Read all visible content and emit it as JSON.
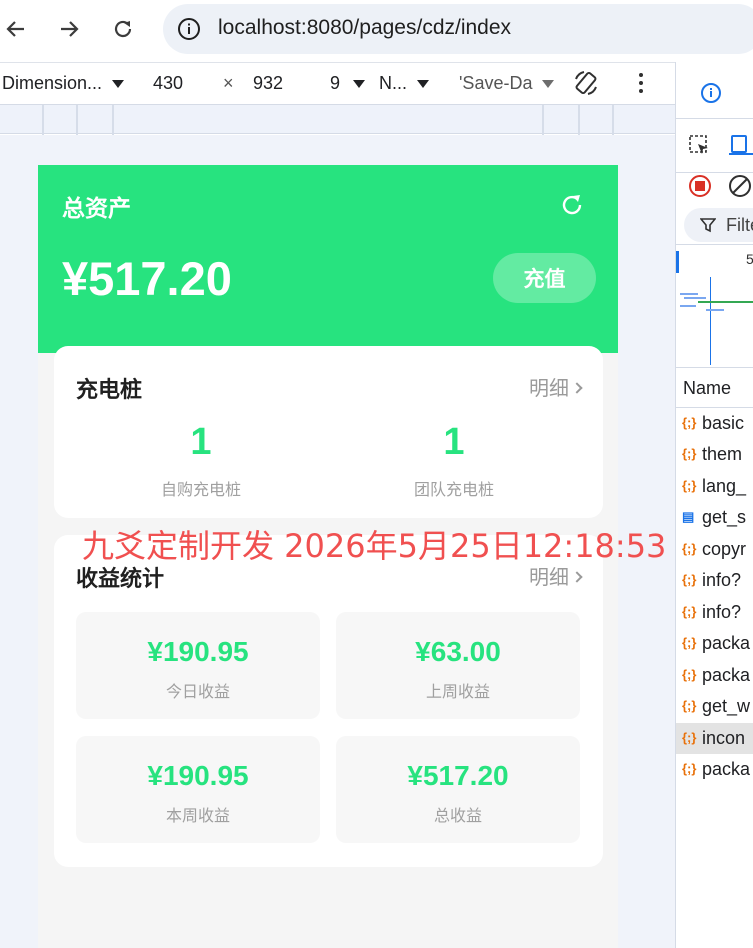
{
  "browser": {
    "url": "localhost:8080/pages/cdz/index"
  },
  "device_toolbar": {
    "dimensions_label": "Dimension...",
    "width": "430",
    "times": "×",
    "height": "932",
    "zoom_partial": "9",
    "throttle_label": "N...",
    "save_data_label": "'Save-Da"
  },
  "app": {
    "total_assets_title": "总资产",
    "balance": "¥517.20",
    "recharge_label": "充值",
    "piles": {
      "title": "充电桩",
      "detail_link": "明细",
      "stats": [
        {
          "value": "1",
          "label": "自购充电桩"
        },
        {
          "value": "1",
          "label": "团队充电桩"
        }
      ]
    },
    "income": {
      "title": "收益统计",
      "detail_link": "明细",
      "tiles": [
        {
          "value": "¥190.95",
          "label": "今日收益"
        },
        {
          "value": "¥63.00",
          "label": "上周收益"
        },
        {
          "value": "¥190.95",
          "label": "本周收益"
        },
        {
          "value": "¥517.20",
          "label": "总收益"
        }
      ]
    },
    "accent_color": "#27e37f"
  },
  "watermark": "九爻定制开发 2026年5月25日12:18:53",
  "devtools": {
    "filter_label": "Filte",
    "timeline_tick": "5",
    "name_header": "Name",
    "requests": [
      {
        "icon": "{;}",
        "name": "basic"
      },
      {
        "icon": "{;}",
        "name": "them"
      },
      {
        "icon": "{;}",
        "name": "lang_"
      },
      {
        "icon": "doc",
        "name": "get_s"
      },
      {
        "icon": "{;}",
        "name": "copyr"
      },
      {
        "icon": "{;}",
        "name": "info?"
      },
      {
        "icon": "{;}",
        "name": "info?"
      },
      {
        "icon": "{;}",
        "name": "packa"
      },
      {
        "icon": "{;}",
        "name": "packa"
      },
      {
        "icon": "{;}",
        "name": "get_w"
      },
      {
        "icon": "{;}",
        "name": "incon"
      },
      {
        "icon": "{;}",
        "name": "packa"
      }
    ]
  }
}
